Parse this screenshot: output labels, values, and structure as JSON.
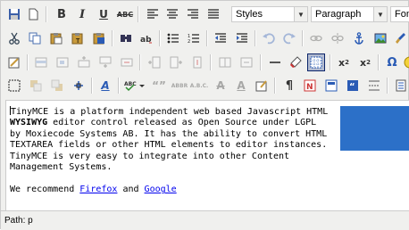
{
  "toolbar": {
    "styles_select": "Styles",
    "format_select": "Paragraph",
    "font_select": "Fon"
  },
  "content": {
    "text_1": "TinyMCE is a platform independent web based Javascript HTML",
    "text_bold": "WYSIWYG",
    "text_2": " editor control released as Open Source under LGPL",
    "text_3": "by Moxiecode Systems AB. It has the ability to convert HTML",
    "text_4": "TEXTAREA fields or other HTML elements to editor instances.",
    "text_5": "TinyMCE is very easy to integrate into other Content",
    "text_6": "Management Systems.",
    "recommend_prefix": "We recommend ",
    "link_firefox": "Firefox",
    "and_text": " and ",
    "link_google": "Google"
  },
  "statusbar": {
    "path_label": "Path: p"
  },
  "colors": {
    "image_block": "#2c70c8",
    "link": "#0000ee",
    "toolbar_bg": "#f0f0ee"
  }
}
